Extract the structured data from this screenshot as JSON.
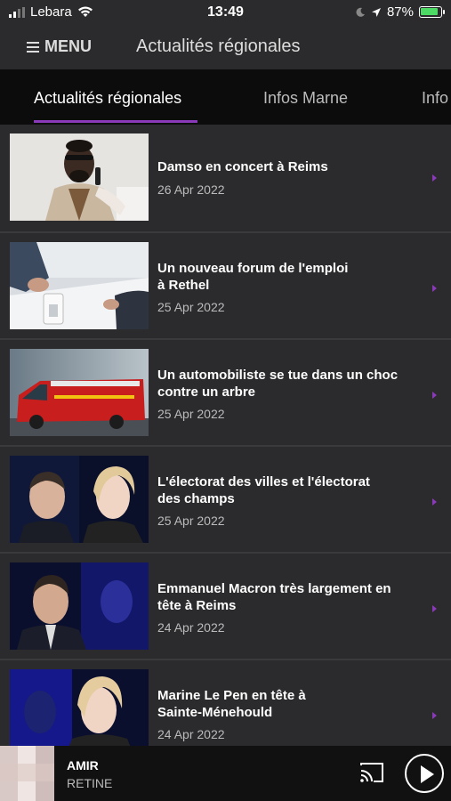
{
  "status_bar": {
    "carrier": "Lebara",
    "time": "13:49",
    "battery_pct": "87%"
  },
  "header": {
    "menu_label": "MENU",
    "title": "Actualités régionales"
  },
  "tabs": [
    {
      "label": "Actualités régionales",
      "active": true
    },
    {
      "label": "Infos Marne",
      "active": false
    },
    {
      "label": "Info",
      "active": false
    }
  ],
  "articles": [
    {
      "title_line1": "Damso en concert à Reims",
      "title_line2": "",
      "date": "26 Apr 2022",
      "image": "artist-portrait-photo"
    },
    {
      "title_line1": "Un nouveau forum de l'emploi",
      "title_line2": "à Rethel",
      "date": "25 Apr 2022",
      "image": "job-interview-photo"
    },
    {
      "title_line1": "Un automobiliste se tue dans un choc",
      "title_line2": "contre un arbre",
      "date": "25 Apr 2022",
      "image": "fire-truck-photo"
    },
    {
      "title_line1": "L'électorat des villes et l'électorat",
      "title_line2": "des champs",
      "date": "25 Apr 2022",
      "image": "candidates-photo"
    },
    {
      "title_line1": "Emmanuel Macron très largement en",
      "title_line2": "tête à Reims",
      "date": "24 Apr 2022",
      "image": "macron-photo"
    },
    {
      "title_line1": "Marine Le Pen en tête à",
      "title_line2": "Sainte-Ménehould",
      "date": "24 Apr 2022",
      "image": "le-pen-photo"
    }
  ],
  "player": {
    "artist": "AMIR",
    "track": "RETINE"
  },
  "colors": {
    "accent": "#8a3ab9",
    "background": "#2b2b2d",
    "tab_bar": "#0c0c0c"
  }
}
